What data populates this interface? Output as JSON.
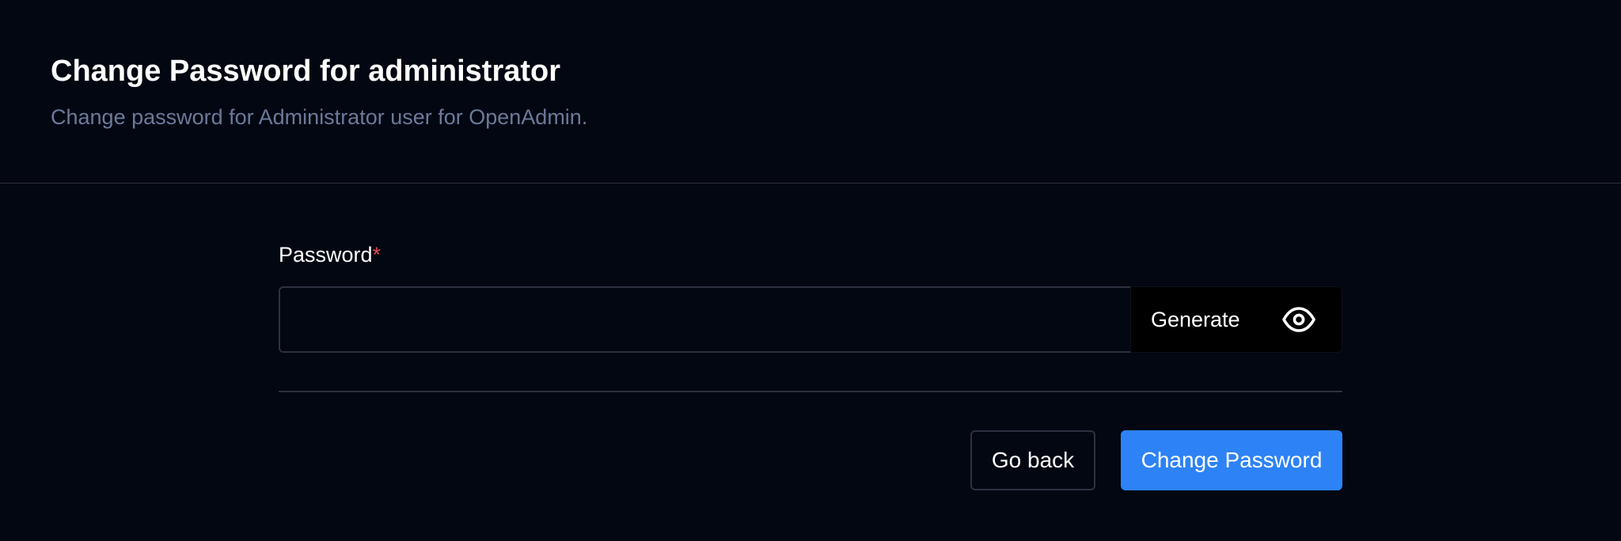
{
  "header": {
    "title": "Change Password for administrator",
    "subtitle": "Change password for Administrator user for OpenAdmin."
  },
  "form": {
    "password": {
      "label": "Password",
      "required_mark": "*",
      "value": "",
      "placeholder": "",
      "generate_label": "Generate",
      "visibility_icon": "eye-icon"
    },
    "actions": {
      "go_back_label": "Go back",
      "submit_label": "Change Password"
    }
  },
  "colors": {
    "background": "#030712",
    "border": "#2b3240",
    "subtitle_text": "#6b7a99",
    "required": "#e5484d",
    "primary": "#2d82f6"
  }
}
